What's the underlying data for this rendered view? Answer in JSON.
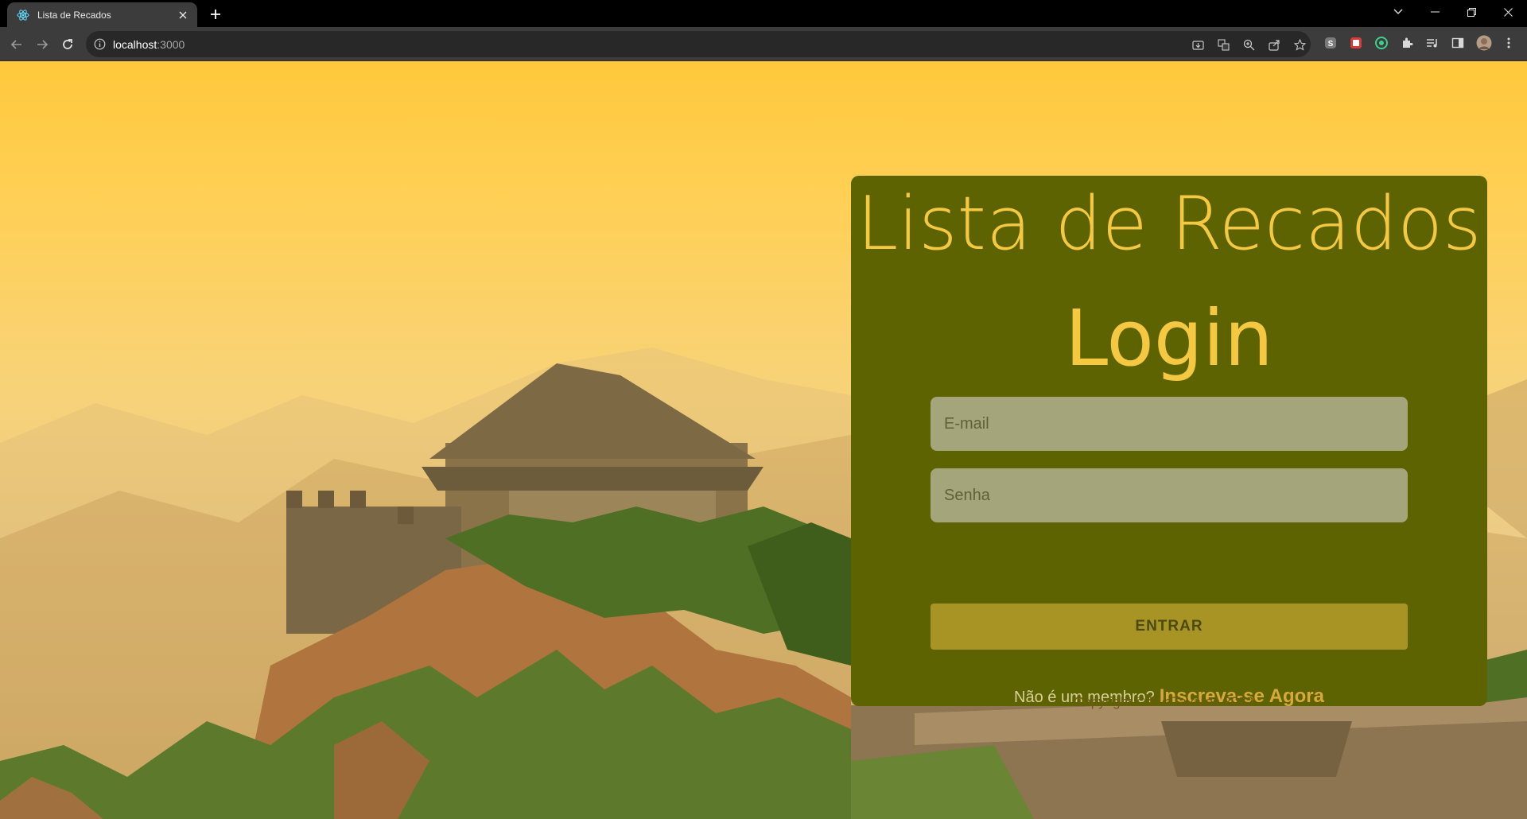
{
  "browser": {
    "tab_title": "Lista de Recados",
    "tab_favicon": "react-icon",
    "url_host": "localhost",
    "url_port": ":3000"
  },
  "page": {
    "app_title": "Lista de Recados",
    "heading": "Login",
    "email_placeholder": "E-mail",
    "password_placeholder": "Senha",
    "submit_label": "ENTRAR",
    "signup_prompt": "Não é um membro?",
    "signup_link": "Inscreva-se Agora",
    "copyright": "Copyright © EvaTavares 2022"
  },
  "colors": {
    "card_bg": "#5c6300",
    "accent": "#f5c842",
    "input_bg": "#a5a57b",
    "button_bg": "#a89424",
    "link": "#d8a93a"
  }
}
